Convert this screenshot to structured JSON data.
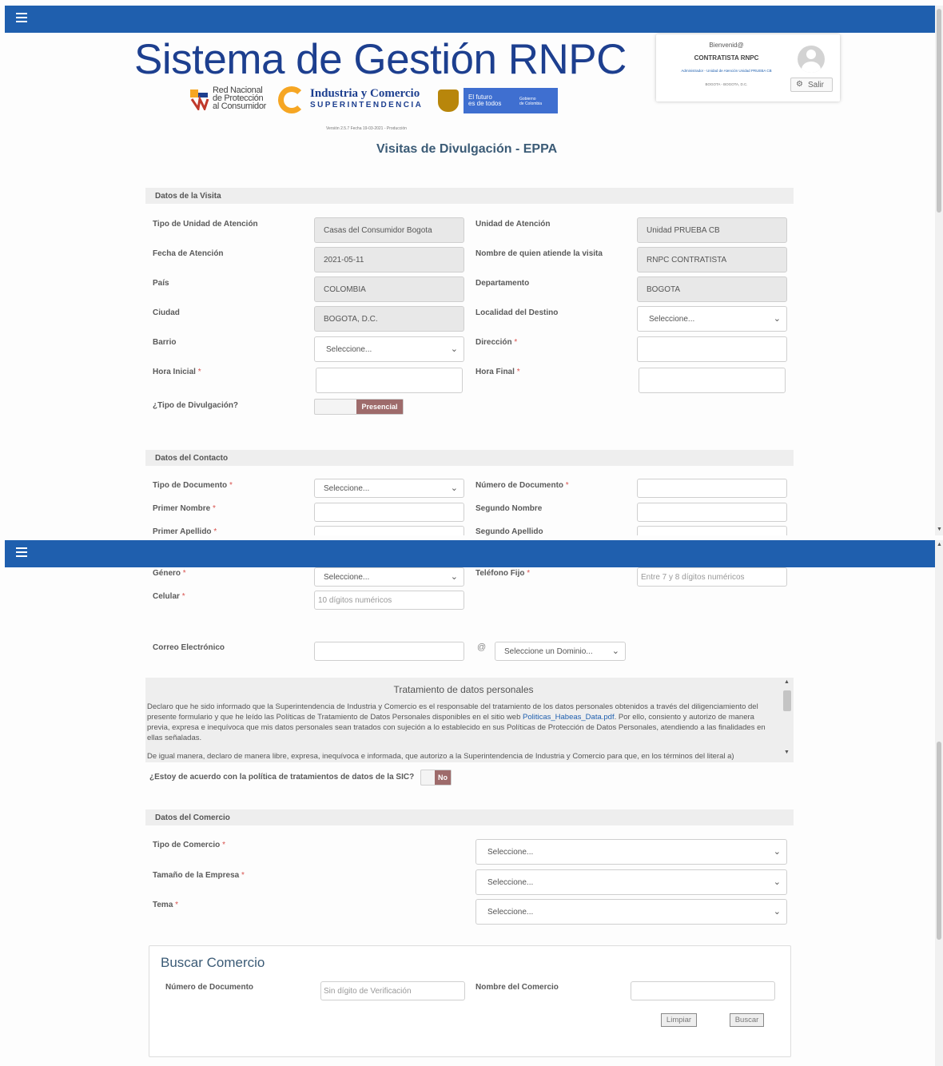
{
  "app_title": "Sistema de Gestión RNPC",
  "logos": {
    "rnpc": [
      "Red Nacional",
      "de Protección",
      "al Consumidor"
    ],
    "sic_name": "Industria y Comercio",
    "sic_sub": "SUPERINTENDENCIA",
    "gov_slogan_1": "El futuro",
    "gov_slogan_2": "es de todos",
    "gov_right_1": "Gobierno",
    "gov_right_2": "de Colombia"
  },
  "version": "Versión 2.5.7 Fecha 19-03-2021 - Producción",
  "page_title": "Visitas de Divulgación - EPPA",
  "user": {
    "greeting": "Bienvenid@",
    "name": "CONTRATISTA RNPC",
    "role": "Administrador - Unidad de Atención Unidad PRUEBA CB",
    "location": "BOGOTA - BOGOTA, D.C.",
    "logout": "Salir"
  },
  "visit": {
    "section": "Datos de la Visita",
    "tipo_unidad_label": "Tipo de Unidad de Atención",
    "tipo_unidad_value": "Casas del Consumidor Bogota",
    "unidad_label": "Unidad de Atención",
    "unidad_value": "Unidad PRUEBA CB",
    "fecha_label": "Fecha de Atención",
    "fecha_value": "2021-05-11",
    "atiende_label": "Nombre de quien atiende la visita",
    "atiende_value": "RNPC CONTRATISTA",
    "pais_label": "País",
    "pais_value": "COLOMBIA",
    "depto_label": "Departamento",
    "depto_value": "BOGOTA",
    "ciudad_label": "Ciudad",
    "ciudad_value": "BOGOTA, D.C.",
    "localidad_label": "Localidad del Destino",
    "localidad_value": "Seleccione...",
    "barrio_label": "Barrio",
    "barrio_value": "Seleccione...",
    "direccion_label": "Dirección",
    "hora_ini_label": "Hora Inicial",
    "hora_fin_label": "Hora Final",
    "tipo_div_label": "¿Tipo de Divulgación?",
    "tipo_div_value": "Presencial"
  },
  "contact": {
    "section": "Datos del Contacto",
    "tipo_doc_label": "Tipo de Documento",
    "tipo_doc_value": "Seleccione...",
    "num_doc_label": "Número de Documento",
    "primer_nombre_label": "Primer Nombre",
    "segundo_nombre_label": "Segundo Nombre",
    "primer_apellido_label": "Primer Apellido",
    "segundo_apellido_label": "Segundo Apellido",
    "genero_label": "Género",
    "genero_value": "Seleccione...",
    "telefono_label": "Teléfono Fijo",
    "telefono_placeholder": "Entre 7 y 8 dígitos numéricos",
    "celular_label": "Celular",
    "celular_placeholder": "10 dígitos numéricos",
    "correo_label": "Correo Electrónico",
    "at": "@",
    "dominio_value": "Seleccione un Dominio..."
  },
  "privacy": {
    "title": "Tratamiento de datos personales",
    "text_before_link": "Declaro que he sido informado que la Superintendencia de Industria y Comercio es el responsable del tratamiento de los datos personales obtenidos a través del diligenciamiento del presente formulario y que he leído las Políticas de Tratamiento de Datos Personales disponibles en el sitio web ",
    "link": "Politicas_Habeas_Data.pdf",
    "text_after_link": ". Por ello, consiento y autorizo de manera previa, expresa e inequívoca que mis datos personales sean tratados con sujeción a lo establecido en sus Políticas de Protección de Datos Personales, atendiendo a las finalidades en ellas señaladas.",
    "text_2": "De igual manera, declaro de manera libre, expresa, inequívoca e informada, que autorizo a la Superintendencia de Industria y Comercio para que, en los términos del literal a)",
    "agree_label": "¿Estoy de acuerdo con la política de tratamientos de datos de la SIC?",
    "agree_value": "No"
  },
  "commerce": {
    "section": "Datos del Comercio",
    "tipo_label": "Tipo de Comercio",
    "tamano_label": "Tamaño de la Empresa",
    "tema_label": "Tema",
    "select_value": "Seleccione..."
  },
  "search": {
    "title": "Buscar Comercio",
    "num_doc_label": "Número de Documento",
    "num_doc_placeholder": "Sin dígito de Verificación",
    "nombre_label": "Nombre del Comercio",
    "clear_button": "Limpiar",
    "search_button": "Buscar"
  },
  "required_mark": "*",
  "colors": {
    "topbar": "#1f5fae",
    "title": "#1d3f8f",
    "toggle_on": "#9e6b6b"
  }
}
